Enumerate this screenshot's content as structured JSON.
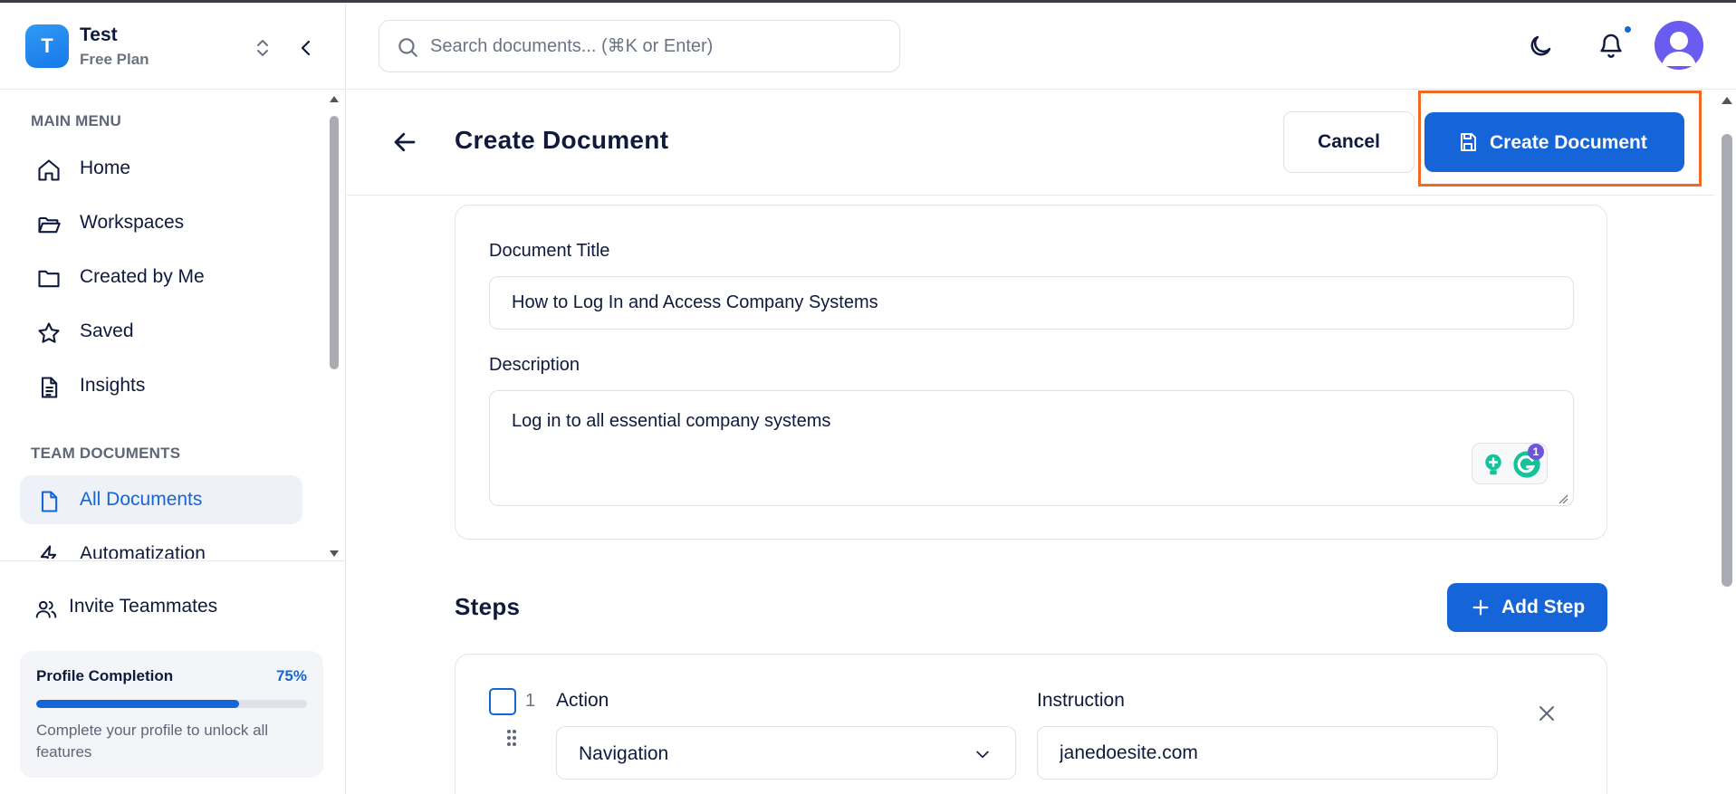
{
  "org": {
    "initial": "T",
    "name": "Test",
    "plan": "Free Plan"
  },
  "sidebar": {
    "main_menu_label": "MAIN MENU",
    "main_items": [
      {
        "label": "Home",
        "icon": "home-icon"
      },
      {
        "label": "Workspaces",
        "icon": "folder-open-icon"
      },
      {
        "label": "Created by Me",
        "icon": "folder-icon"
      },
      {
        "label": "Saved",
        "icon": "star-icon"
      },
      {
        "label": "Insights",
        "icon": "document-lines-icon"
      }
    ],
    "team_label": "TEAM DOCUMENTS",
    "team_items": [
      {
        "label": "All Documents",
        "icon": "file-icon",
        "active": true
      },
      {
        "label": "Automatization",
        "icon": "lightning-icon"
      }
    ],
    "invite_label": "Invite Teammates",
    "profile": {
      "title": "Profile Completion",
      "percent_label": "75%",
      "progress": 0.75,
      "description": "Complete your profile to unlock all features"
    }
  },
  "search": {
    "placeholder": "Search documents... (⌘K or Enter)",
    "value": ""
  },
  "header": {
    "title": "Create Document",
    "cancel_label": "Cancel",
    "create_label": "Create Document"
  },
  "form": {
    "title_label": "Document Title",
    "title_value": "How to Log In and Access Company Systems",
    "description_label": "Description",
    "description_value": "Log in to all essential company systems",
    "grammarly_count": "1"
  },
  "steps": {
    "title": "Steps",
    "add_label": "Add Step",
    "items": [
      {
        "number": "1",
        "action_label": "Action",
        "action_value": "Navigation",
        "instruction_label": "Instruction",
        "instruction_value": "janedoesite.com"
      }
    ]
  },
  "colors": {
    "accent": "#1565d8",
    "highlight": "#f06a24",
    "text": "#0f1a3d"
  }
}
